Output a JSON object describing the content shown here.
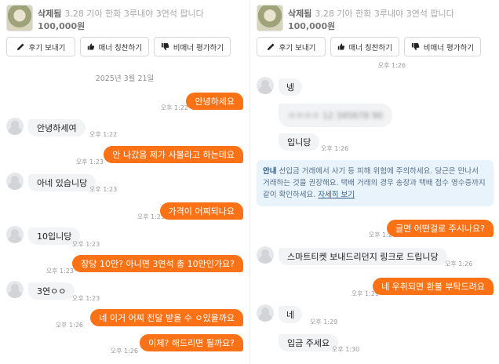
{
  "product": {
    "status": "삭제됨",
    "title": "3.28 기아 한화 3루내야 3연석 팝니다",
    "price": "100,000원"
  },
  "actions": {
    "review": "후기 보내기",
    "manner": "매너 칭찬하기",
    "bad_manner": "비매너 평가하기"
  },
  "left": {
    "date": "2025년 3월 21일",
    "messages": [
      {
        "text": "안녕하세요",
        "time": "오후 1:22"
      },
      {
        "text": "안녕하세여",
        "time": "오후 1:22"
      },
      {
        "text": "안 나갔음 제가 사볼라고 하는데요",
        "time": "오후 1:23"
      },
      {
        "text": "아네 있습니당",
        "time": "오후 1:23"
      },
      {
        "text": "가격이 어찌되나요",
        "time": "오후 1:23"
      },
      {
        "text": "10입니당",
        "time": "오후 1:23"
      },
      {
        "text": "장당 10만? 아니면 3연석 총 10만인가요?",
        "time": "오후 1:23"
      },
      {
        "text": "3연ㅇㅇ",
        "time": "오후 1:23"
      },
      {
        "text": "네 이거 어찌 전달 받을 수 ㅇ있을까요",
        "time": "오후 1:26"
      },
      {
        "text": "이체? 해드리면 될까요?",
        "time": "오후 1:26"
      }
    ]
  },
  "right": {
    "messages": [
      {
        "text": "넹",
        "time": ""
      },
      {
        "text": "",
        "time": ""
      },
      {
        "text": "입니당",
        "time": "오후 1:26"
      },
      {
        "text": "글면 어떤걸로 주시나요?",
        "time": "오후 1:26"
      },
      {
        "text": "스마트티켓 보내드리던지 링크로 드립니당",
        "time": "오후 1:26"
      },
      {
        "text": "네 우취되면 환불 부탁드려요",
        "time": "오후 1:29"
      },
      {
        "text": "네",
        "time": "오후 1:29"
      },
      {
        "text": "입금 주세요",
        "time": "오후 1:30"
      }
    ],
    "top_time": "오후 1:26",
    "notice": {
      "label": "안내",
      "text": "선입금 거래에서 사기 등 피해 위험에 주의하세요. 당근은 만나서 거래하는 것을 권장해요. 택배 거래의 경우 송장과 택배 접수 영수증까지 같이 확인하세요.",
      "link": "자세히 보기"
    }
  }
}
